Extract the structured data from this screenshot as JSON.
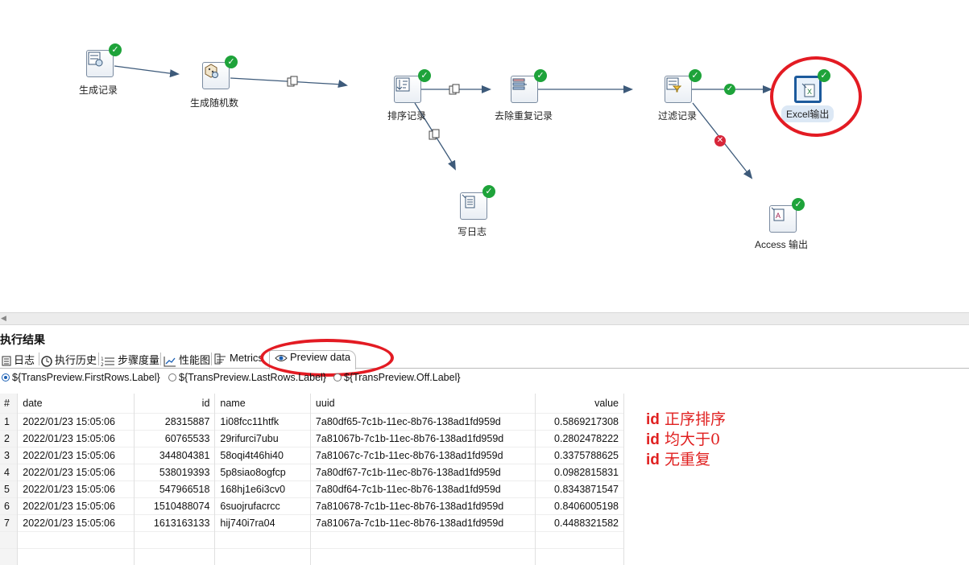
{
  "steps": {
    "generate_rows": "生成记录",
    "random_numbers": "生成随机数",
    "sort_rows": "排序记录",
    "unique_rows": "去除重复记录",
    "filter_rows": "过滤记录",
    "excel_output": "Excel输出",
    "write_log": "写日志",
    "access_output": "Access 输出"
  },
  "results": {
    "title": "执行结果",
    "tabs": [
      "日志",
      "执行历史",
      "步骤度量",
      "性能图",
      "Metrics",
      "Preview data"
    ],
    "radios": [
      "${TransPreview.FirstRows.Label}",
      "${TransPreview.LastRows.Label}",
      "${TransPreview.Off.Label}"
    ],
    "selected_radio": 0
  },
  "table": {
    "columns": [
      "#",
      "date",
      "id",
      "name",
      "uuid",
      "value"
    ],
    "rows": [
      [
        "1",
        "2022/01/23 15:05:06",
        "28315887",
        "1i08fcc11htfk",
        "7a80df65-7c1b-11ec-8b76-138ad1fd959d",
        "0.5869217308"
      ],
      [
        "2",
        "2022/01/23 15:05:06",
        "60765533",
        "29rifurci7ubu",
        "7a81067b-7c1b-11ec-8b76-138ad1fd959d",
        "0.2802478222"
      ],
      [
        "3",
        "2022/01/23 15:05:06",
        "344804381",
        "58oqi4t46hi40",
        "7a81067c-7c1b-11ec-8b76-138ad1fd959d",
        "0.3375788625"
      ],
      [
        "4",
        "2022/01/23 15:05:06",
        "538019393",
        "5p8siao8ogfcp",
        "7a80df67-7c1b-11ec-8b76-138ad1fd959d",
        "0.0982815831"
      ],
      [
        "5",
        "2022/01/23 15:05:06",
        "547966518",
        "168hj1e6i3cv0",
        "7a80df64-7c1b-11ec-8b76-138ad1fd959d",
        "0.8343871547"
      ],
      [
        "6",
        "2022/01/23 15:05:06",
        "1510488074",
        "6suojrufacrcc",
        "7a810678-7c1b-11ec-8b76-138ad1fd959d",
        "0.8406005198"
      ],
      [
        "7",
        "2022/01/23 15:05:06",
        "1613163133",
        "hij740i7ra04",
        "7a81067a-7c1b-11ec-8b76-138ad1fd959d",
        "0.4488321582"
      ]
    ]
  },
  "notes": [
    {
      "key": "id",
      "text": "正序排序"
    },
    {
      "key": "id",
      "text": "均大于0"
    },
    {
      "key": "id",
      "text": "无重复"
    }
  ],
  "colors": {
    "ok": "#1ea33a",
    "error": "#d8263a",
    "annotation": "#e31b23",
    "hop": "#3d5a7a"
  }
}
